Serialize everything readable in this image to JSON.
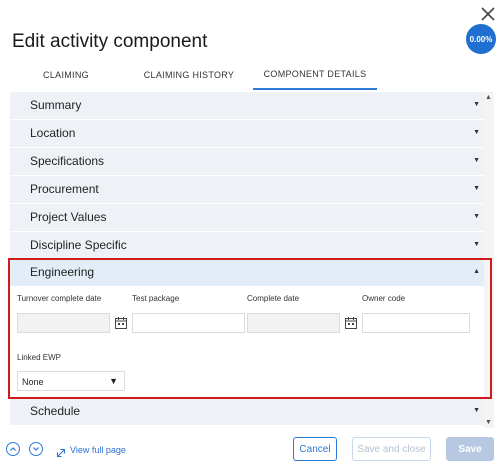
{
  "dialog": {
    "title": "Edit activity component",
    "progress_badge": "0.00%"
  },
  "tabs": [
    {
      "label": "CLAIMING"
    },
    {
      "label": "CLAIMING HISTORY"
    },
    {
      "label": "COMPONENT DETAILS",
      "active": true
    }
  ],
  "sections": [
    {
      "label": "Summary",
      "expanded": false
    },
    {
      "label": "Location",
      "expanded": false
    },
    {
      "label": "Specifications",
      "expanded": false
    },
    {
      "label": "Procurement",
      "expanded": false
    },
    {
      "label": "Project Values",
      "expanded": false
    },
    {
      "label": "Discipline Specific",
      "expanded": false
    },
    {
      "label": "Engineering",
      "expanded": true
    },
    {
      "label": "Schedule",
      "expanded": false
    }
  ],
  "engineering": {
    "fields": [
      {
        "label": "Turnover complete date",
        "value": ""
      },
      {
        "label": "Test package",
        "value": ""
      },
      {
        "label": "Complete date",
        "value": ""
      },
      {
        "label": "Owner code",
        "value": ""
      }
    ],
    "linked_ewp": {
      "label": "Linked EWP",
      "value": "None"
    }
  },
  "footer": {
    "view_full_page": "View full page",
    "cancel": "Cancel",
    "save_and_close": "Save and close",
    "save": "Save"
  },
  "colors": {
    "accent": "#2a7ad6",
    "highlight_border": "#d11a1a",
    "section_bg": "#eef2f7",
    "badge_bg": "#1e6fd0"
  }
}
